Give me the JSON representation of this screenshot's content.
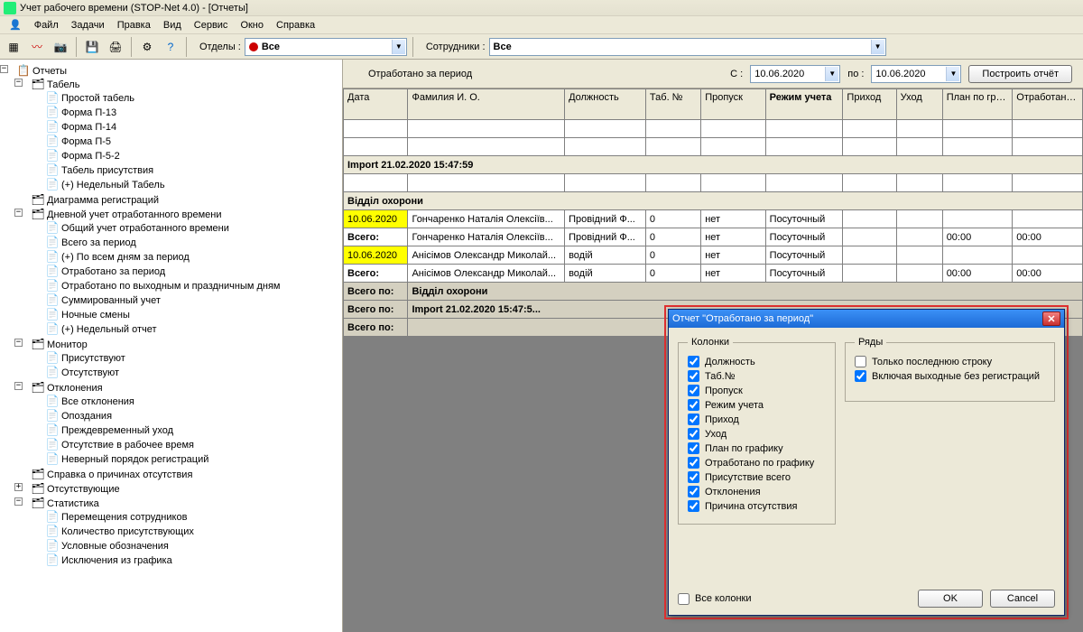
{
  "title": "Учет рабочего времени (STOP-Net 4.0) - [Отчеты]",
  "menus": [
    "Файл",
    "Задачи",
    "Правка",
    "Вид",
    "Сервис",
    "Окно",
    "Справка"
  ],
  "toolbar": {
    "departments_label": "Отделы :",
    "departments_value": "Все",
    "employees_label": "Сотрудники :",
    "employees_value": "Все"
  },
  "tree": {
    "root": "Отчеты",
    "tabel": {
      "label": "Табель",
      "children": [
        "Простой табель",
        "Форма П-13",
        "Форма П-14",
        "Форма П-5",
        "Форма П-5-2",
        "Табель присутствия",
        "(+) Недельный Табель"
      ]
    },
    "diag": "Диаграмма регистраций",
    "daily": {
      "label": "Дневной учет отработанного времени",
      "children": [
        "Общий учет отработанного времени",
        "Всего за период",
        "(+) По всем дням за период",
        "Отработано за период",
        "Отработано по выходным и праздничным дням",
        "Суммированный учет",
        "Ночные смены",
        "(+) Недельный отчет"
      ]
    },
    "monitor": {
      "label": "Монитор",
      "children": [
        "Присутствуют",
        "Отсутствуют"
      ]
    },
    "dev": {
      "label": "Отклонения",
      "children": [
        "Все отклонения",
        "Опоздания",
        "Преждевременный уход",
        "Отсутствие в рабочее время",
        "Неверный порядок регистраций"
      ]
    },
    "absence_cert": "Справка о причинах отсутствия",
    "absent": "Отсутствующие",
    "stats": {
      "label": "Статистика",
      "children": [
        "Перемещения сотрудников",
        "Количество присутствующих",
        "Условные обозначения",
        "Исключения из графика"
      ]
    }
  },
  "report": {
    "title": "Отработано за период",
    "from_label": "С :",
    "to_label": "по :",
    "from_date": "10.06.2020",
    "to_date": "10.06.2020",
    "build_btn": "Построить отчёт",
    "columns": [
      "Дата",
      "Фамилия И. О.",
      "Должность",
      "Таб. №",
      "Пропуск",
      "Режим учета",
      "Приход",
      "Уход",
      "План по графику",
      "Отработано по графику"
    ],
    "bold_col": "Режим учета",
    "import_group": "Import 21.02.2020 15:47:59",
    "dept_group": "Відділ охорони",
    "rows": [
      {
        "date": "10.06.2020",
        "fio": "Гончаренко Наталія Олексіїв...",
        "pos": "Провідний Ф...",
        "tab": "0",
        "pass": "нет",
        "mode": "Посуточный",
        "in": "",
        "out": "",
        "plan": "",
        "done": "",
        "hl": true
      },
      {
        "date": "Всего:",
        "fio": "Гончаренко Наталія Олексіїв...",
        "pos": "Провідний Ф...",
        "tab": "0",
        "pass": "нет",
        "mode": "Посуточный",
        "in": "",
        "out": "",
        "plan": "00:00",
        "done": "00:00",
        "total": true
      },
      {
        "date": "10.06.2020",
        "fio": "Анісімов Олександр Миколай...",
        "pos": "водій",
        "tab": "0",
        "pass": "нет",
        "mode": "Посуточный",
        "in": "",
        "out": "",
        "plan": "",
        "done": "",
        "hl": true
      },
      {
        "date": "Всего:",
        "fio": "Анісімов Олександр Миколай...",
        "pos": "водій",
        "tab": "0",
        "pass": "нет",
        "mode": "Посуточный",
        "in": "",
        "out": "",
        "plan": "00:00",
        "done": "00:00",
        "total": true
      }
    ],
    "total_dept_label": "Всего по:",
    "total_dept_value": "Відділ охорони",
    "total_import_label": "Всего по:",
    "total_import_value": "Import 21.02.2020 15:47:5...",
    "grand_total": "Всего по:"
  },
  "dialog": {
    "title": "Отчет \"Отработано за период\"",
    "columns_group": "Колонки",
    "rows_group": "Ряды",
    "columns": [
      "Должность",
      "Таб.№",
      "Пропуск",
      "Режим учета",
      "Приход",
      "Уход",
      "План по графику",
      "Отработано по графику",
      "Присутствие всего",
      "Отклонения",
      "Причина отсутствия"
    ],
    "all_columns": "Все колонки",
    "rows": [
      {
        "label": "Только последнюю строку",
        "checked": false
      },
      {
        "label": "Включая выходные без регистраций",
        "checked": true
      }
    ],
    "ok": "OK",
    "cancel": "Cancel"
  }
}
